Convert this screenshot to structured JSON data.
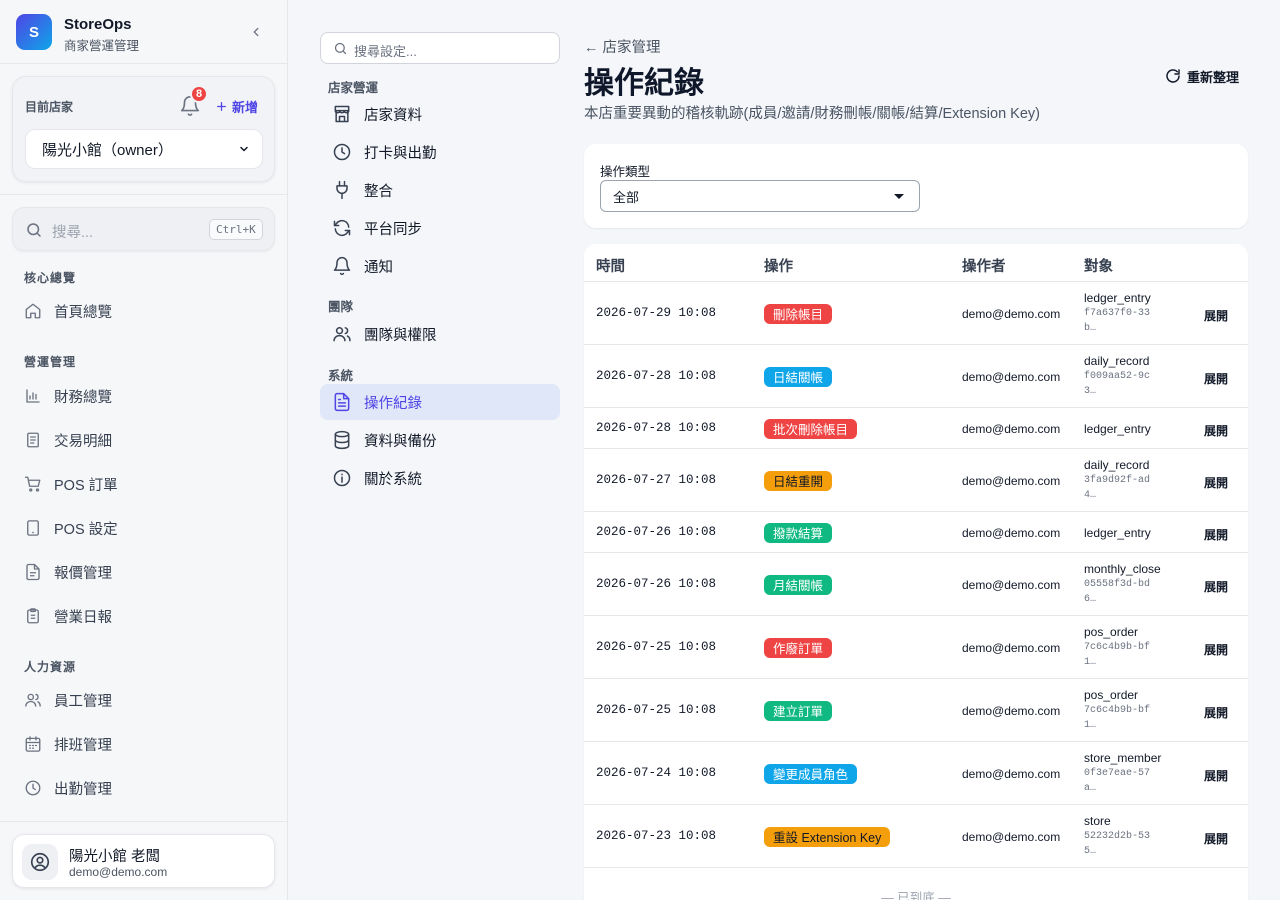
{
  "brand": {
    "logo_letter": "S",
    "name": "StoreOps",
    "subtitle": "商家營運管理"
  },
  "store": {
    "label": "目前店家",
    "notification_count": "8",
    "add_label": "新增",
    "selected": "陽光小館（owner）"
  },
  "sidebar_search": {
    "placeholder": "搜尋...",
    "shortcut": "Ctrl+K"
  },
  "sidebar": {
    "sections": [
      {
        "title": "核心總覽",
        "items": [
          {
            "label": "首頁總覽",
            "icon": "home-icon"
          }
        ]
      },
      {
        "title": "營運管理",
        "items": [
          {
            "label": "財務總覽",
            "icon": "bar-chart-icon"
          },
          {
            "label": "交易明細",
            "icon": "receipt-icon"
          },
          {
            "label": "POS 訂單",
            "icon": "cart-icon"
          },
          {
            "label": "POS 設定",
            "icon": "tablet-icon"
          },
          {
            "label": "報價管理",
            "icon": "document-icon"
          },
          {
            "label": "營業日報",
            "icon": "clipboard-icon"
          }
        ]
      },
      {
        "title": "人力資源",
        "items": [
          {
            "label": "員工管理",
            "icon": "users-icon"
          },
          {
            "label": "排班管理",
            "icon": "calendar-icon"
          },
          {
            "label": "出勤管理",
            "icon": "clock-icon"
          }
        ]
      }
    ]
  },
  "user": {
    "name": "陽光小館 老闆",
    "email": "demo@demo.com"
  },
  "settings_nav": {
    "search_placeholder": "搜尋設定...",
    "sections": [
      {
        "title": "店家營運",
        "items": [
          {
            "label": "店家資料",
            "icon": "store-icon"
          },
          {
            "label": "打卡與出勤",
            "icon": "clock-icon"
          },
          {
            "label": "整合",
            "icon": "plug-icon"
          },
          {
            "label": "平台同步",
            "icon": "refresh-icon"
          },
          {
            "label": "通知",
            "icon": "bell-icon"
          }
        ]
      },
      {
        "title": "團隊",
        "items": [
          {
            "label": "團隊與權限",
            "icon": "users-icon"
          }
        ]
      },
      {
        "title": "系統",
        "items": [
          {
            "label": "操作紀錄",
            "icon": "file-text-icon",
            "active": true
          },
          {
            "label": "資料與備份",
            "icon": "database-icon"
          },
          {
            "label": "關於系統",
            "icon": "info-icon"
          }
        ]
      }
    ]
  },
  "page": {
    "back_label": "← 店家管理",
    "title": "操作紀錄",
    "description": "本店重要異動的稽核軌跡(成員/邀請/財務刪帳/關帳/結算/Extension Key)",
    "refresh_label": "重新整理"
  },
  "filter": {
    "label": "操作類型",
    "selected": "全部"
  },
  "table": {
    "columns": [
      "時間",
      "操作",
      "操作者",
      "對象"
    ],
    "expand_label": "展開",
    "rows": [
      {
        "time": "2026-07-29 10:08",
        "action": "刪除帳目",
        "color": "red",
        "actor": "demo@demo.com",
        "target": "ledger_entry",
        "target_id": "f7a637f0-33b…"
      },
      {
        "time": "2026-07-28 10:08",
        "action": "日結關帳",
        "color": "blue",
        "actor": "demo@demo.com",
        "target": "daily_record",
        "target_id": "f009aa52-9c3…"
      },
      {
        "time": "2026-07-28 10:08",
        "action": "批次刪除帳目",
        "color": "red",
        "actor": "demo@demo.com",
        "target": "ledger_entry",
        "target_id": ""
      },
      {
        "time": "2026-07-27 10:08",
        "action": "日結重開",
        "color": "amber",
        "actor": "demo@demo.com",
        "target": "daily_record",
        "target_id": "3fa9d92f-ad4…"
      },
      {
        "time": "2026-07-26 10:08",
        "action": "撥款結算",
        "color": "green",
        "actor": "demo@demo.com",
        "target": "ledger_entry",
        "target_id": ""
      },
      {
        "time": "2026-07-26 10:08",
        "action": "月結關帳",
        "color": "green",
        "actor": "demo@demo.com",
        "target": "monthly_close",
        "target_id": "05558f3d-bd6…"
      },
      {
        "time": "2026-07-25 10:08",
        "action": "作廢訂單",
        "color": "red",
        "actor": "demo@demo.com",
        "target": "pos_order",
        "target_id": "7c6c4b9b-bf1…"
      },
      {
        "time": "2026-07-25 10:08",
        "action": "建立訂單",
        "color": "green",
        "actor": "demo@demo.com",
        "target": "pos_order",
        "target_id": "7c6c4b9b-bf1…"
      },
      {
        "time": "2026-07-24 10:08",
        "action": "變更成員角色",
        "color": "blue",
        "actor": "demo@demo.com",
        "target": "store_member",
        "target_id": "0f3e7eae-57a…"
      },
      {
        "time": "2026-07-23 10:08",
        "action": "重設 Extension Key",
        "color": "amber",
        "actor": "demo@demo.com",
        "target": "store",
        "target_id": "52232d2b-535…"
      }
    ],
    "end_note": "— 已到底 —"
  },
  "colors": {
    "accent": "#4f46e5",
    "danger": "#ef4444",
    "info": "#0ea5e9",
    "warning": "#f59e0b",
    "success": "#10b981"
  }
}
